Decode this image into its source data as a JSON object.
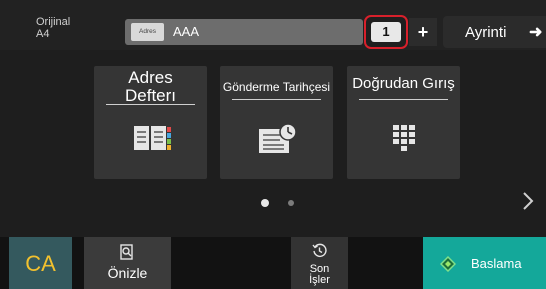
{
  "header": {
    "original_label": "Orijinal",
    "original_size": "A4",
    "address_chip": "Adres",
    "address_value": "AAA",
    "copies": "1",
    "plus_label": "+",
    "detail_label": "Ayrinti",
    "detail_arrow": "➜"
  },
  "tiles": [
    {
      "title_line1": "Adres",
      "title_line2": "Defterı",
      "icon": "address-book-icon"
    },
    {
      "title": "Gönderme Tarihçesi",
      "icon": "send-history-icon"
    },
    {
      "title": "Doğrudan Gırış",
      "icon": "keypad-icon"
    }
  ],
  "pager": {
    "pages": 2,
    "current": 1
  },
  "footer": {
    "ca_label": "CA",
    "preview_label": "Önizle",
    "jobs_label_line1": "Son",
    "jobs_label_line2": "İşler",
    "start_label": "Baslama"
  },
  "colors": {
    "ca_button": "#34595e",
    "ca_text": "#f2c12e",
    "start_button": "#14a89a",
    "copies_highlight": "#d8202b"
  }
}
